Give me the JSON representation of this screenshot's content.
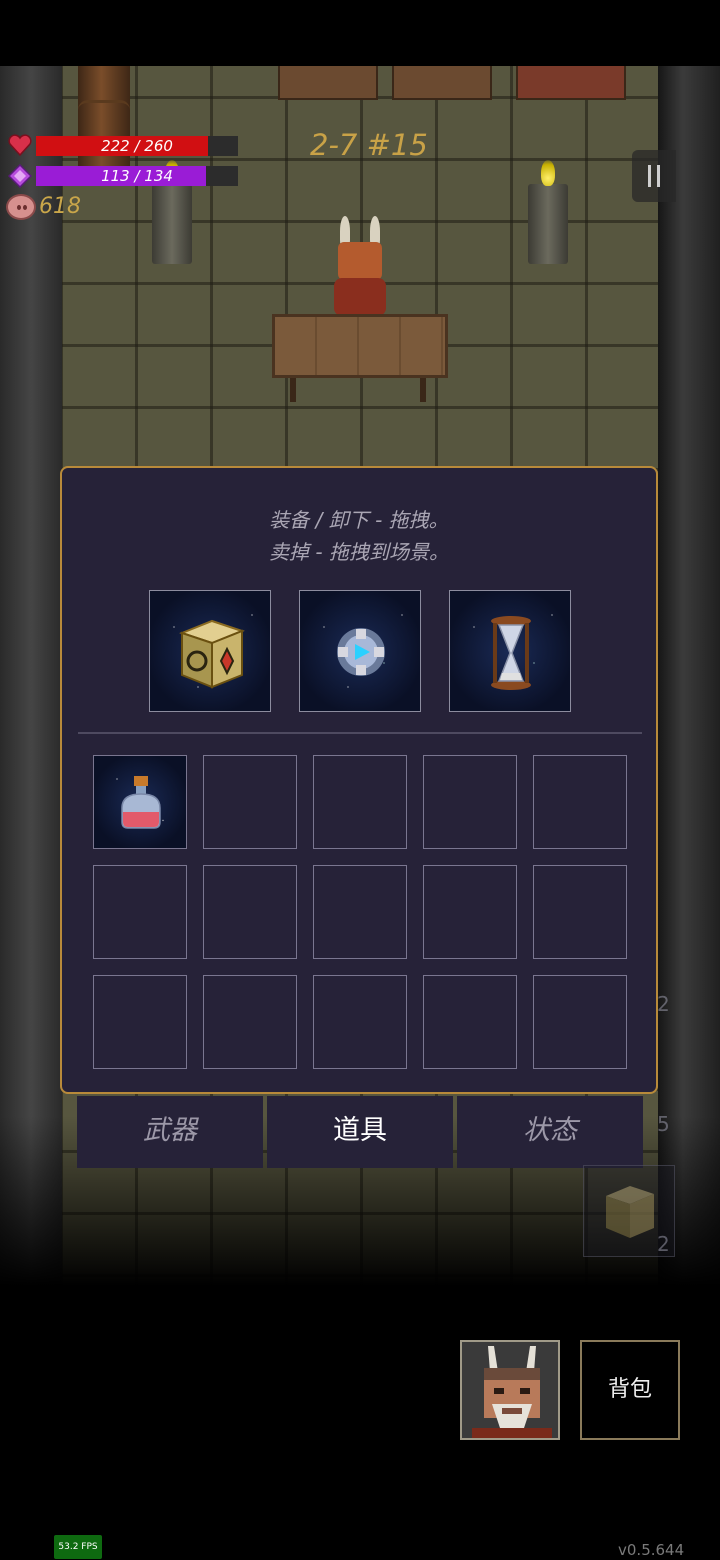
{
  "hud": {
    "hp": {
      "current": 222,
      "max": 260,
      "text": "222 / 260",
      "color": "#d10f12"
    },
    "mp": {
      "current": 113,
      "max": 134,
      "text": "113 / 134",
      "color": "#9a1cd6"
    },
    "gold": "618",
    "stage": "2-7 #15",
    "icons": {
      "hp": "heart-icon",
      "mp": "diamond-icon",
      "gold": "pig-icon",
      "pause": "pause-icon"
    }
  },
  "inventory": {
    "hint_line1": "装备 / 卸下 - 拖拽。",
    "hint_line2": "卖掉 - 拖拽到场景。",
    "equipped": [
      {
        "icon": "golden-cube-icon"
      },
      {
        "icon": "blue-orb-icon"
      },
      {
        "icon": "hourglass-icon"
      }
    ],
    "slots": [
      {
        "icon": "potion-flask-icon"
      }
    ],
    "empty_slots": 14
  },
  "tabs": [
    {
      "label": "武器",
      "active": false
    },
    {
      "label": "道具",
      "active": true
    },
    {
      "label": "状态",
      "active": false
    }
  ],
  "side": {
    "num_a": "2",
    "num_b": "5",
    "num_c": "2"
  },
  "bottom": {
    "bag_label": "背包",
    "fps": "53.2 FPS",
    "version": "v0.5.644"
  },
  "colors": {
    "panel_border": "#b88a3a",
    "panel_bg": "#262238",
    "stage_text": "#c9a247",
    "gold_text": "#c9a64a"
  }
}
